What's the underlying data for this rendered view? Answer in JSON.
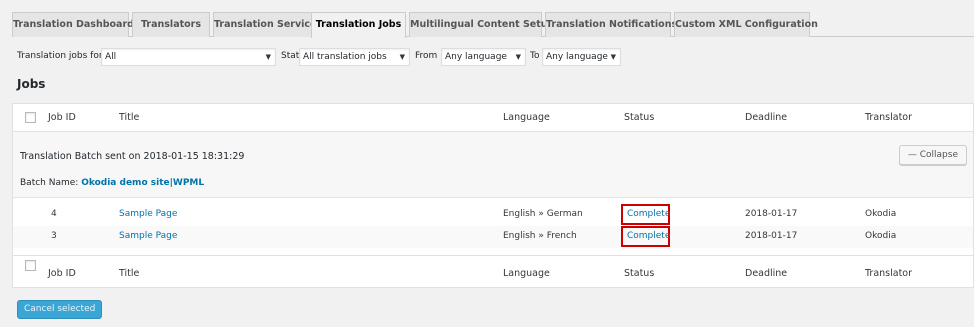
{
  "tabs": [
    {
      "label": "Translation Dashboard"
    },
    {
      "label": "Translators"
    },
    {
      "label": "Translation Services"
    },
    {
      "label": "Translation Jobs"
    },
    {
      "label": "Multilingual Content Setup"
    },
    {
      "label": "Translation Notifications"
    },
    {
      "label": "Custom XML Configuration"
    }
  ],
  "filters": {
    "jobs_for_label": "Translation jobs for:",
    "jobs_for_value": "All",
    "status_label": "Status",
    "status_value": "All translation jobs",
    "from_label": "From",
    "from_value": "Any language",
    "to_label": "To",
    "to_value": "Any language"
  },
  "jobs_heading": "Jobs",
  "columns": {
    "job_id": "Job ID",
    "title": "Title",
    "language": "Language",
    "status": "Status",
    "deadline": "Deadline",
    "translator": "Translator"
  },
  "batch": {
    "title": "Translation Batch sent on 2018-01-15 18:31:29",
    "name_label": "Batch Name:",
    "name_value": "Okodia demo site|WPML",
    "collapse_label": "— Collapse"
  },
  "rows": [
    {
      "job_id": "4",
      "title": "Sample Page",
      "language": "English » German",
      "status": "Complete",
      "deadline": "2018-01-17",
      "translator": "Okodia"
    },
    {
      "job_id": "3",
      "title": "Sample Page",
      "language": "English » French",
      "status": "Complete",
      "deadline": "2018-01-17",
      "translator": "Okodia"
    }
  ],
  "cancel_selected_label": "Cancel selected",
  "colors": {
    "accent": "#0073aa",
    "highlight": "#cc0000",
    "button": "#39a6d6"
  }
}
